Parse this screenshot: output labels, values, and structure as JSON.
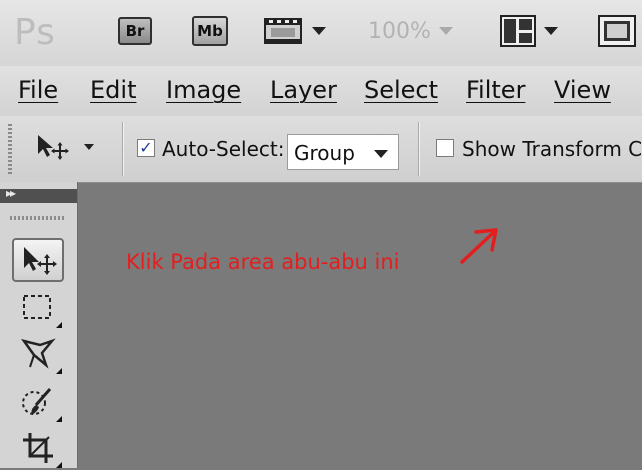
{
  "appbar": {
    "logo": "Ps",
    "bridge_label": "Br",
    "minibridge_label": "Mb",
    "zoom": "100%"
  },
  "menu": {
    "items": [
      "File",
      "Edit",
      "Image",
      "Layer",
      "Select",
      "Filter",
      "View"
    ]
  },
  "options": {
    "auto_select_label": "Auto-Select:",
    "auto_select_checked": true,
    "auto_select_mode": "Group",
    "show_transform_label": "Show Transform Co",
    "show_transform_checked": false
  },
  "annotation": {
    "text": "Klik Pada area abu-abu ini",
    "color": "#e41e1e"
  },
  "tools": [
    "move-tool-icon",
    "marquee-tool-icon",
    "lasso-tool-icon",
    "quick-selection-tool-icon",
    "crop-tool-icon"
  ]
}
